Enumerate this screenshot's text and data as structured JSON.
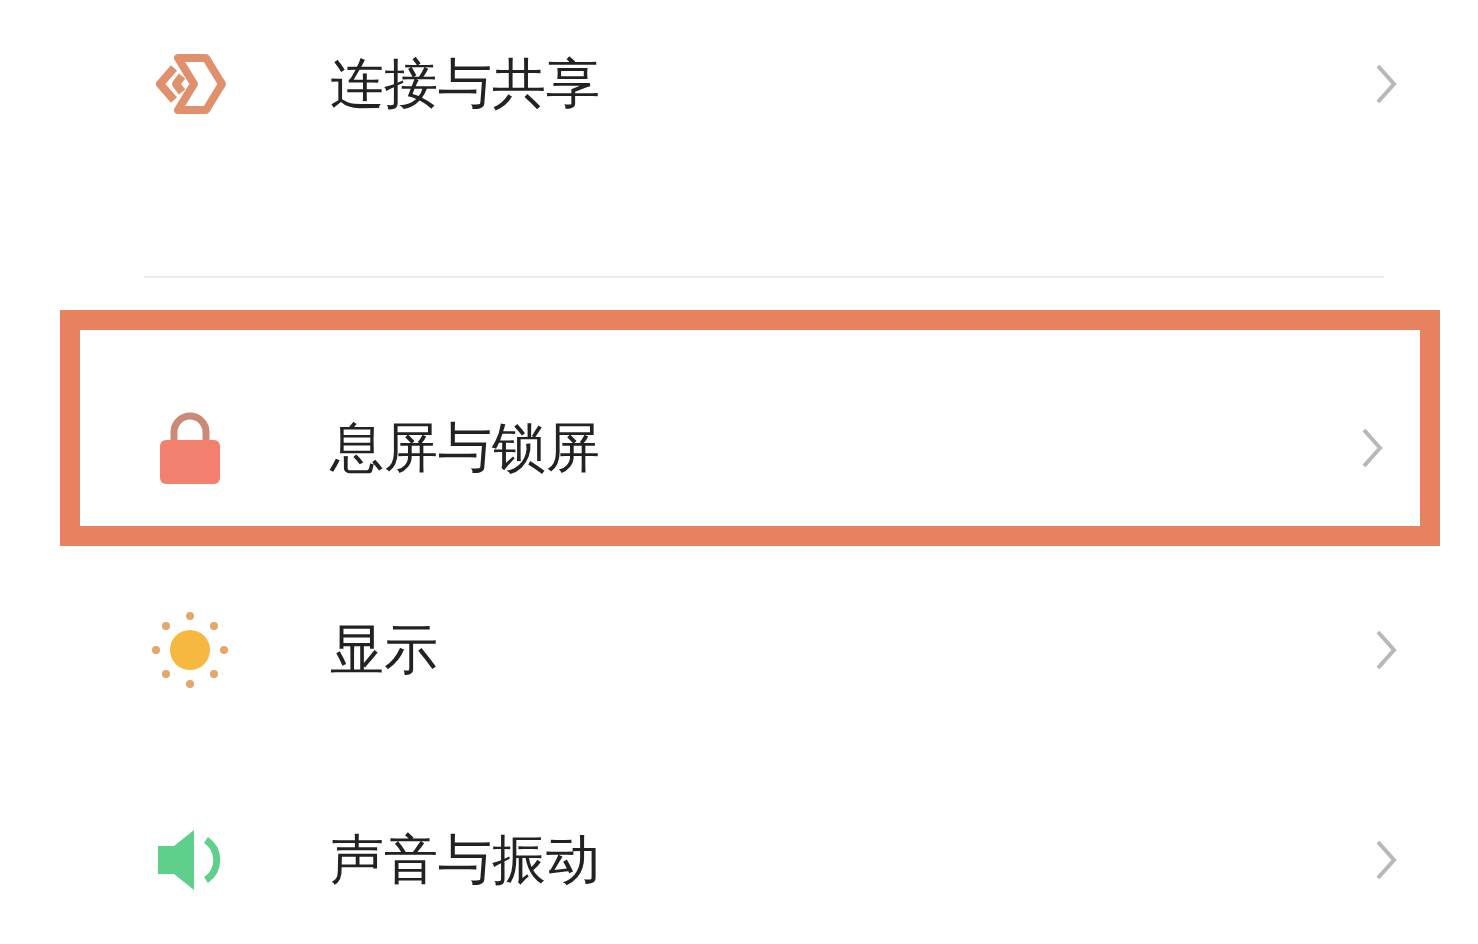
{
  "groups": [
    {
      "items": [
        {
          "label": "连接与共享",
          "highlighted": false
        }
      ]
    },
    {
      "items": [
        {
          "label": "息屏与锁屏",
          "highlighted": true
        },
        {
          "label": "显示",
          "highlighted": false
        },
        {
          "label": "声音与振动",
          "highlighted": false
        }
      ]
    }
  ]
}
